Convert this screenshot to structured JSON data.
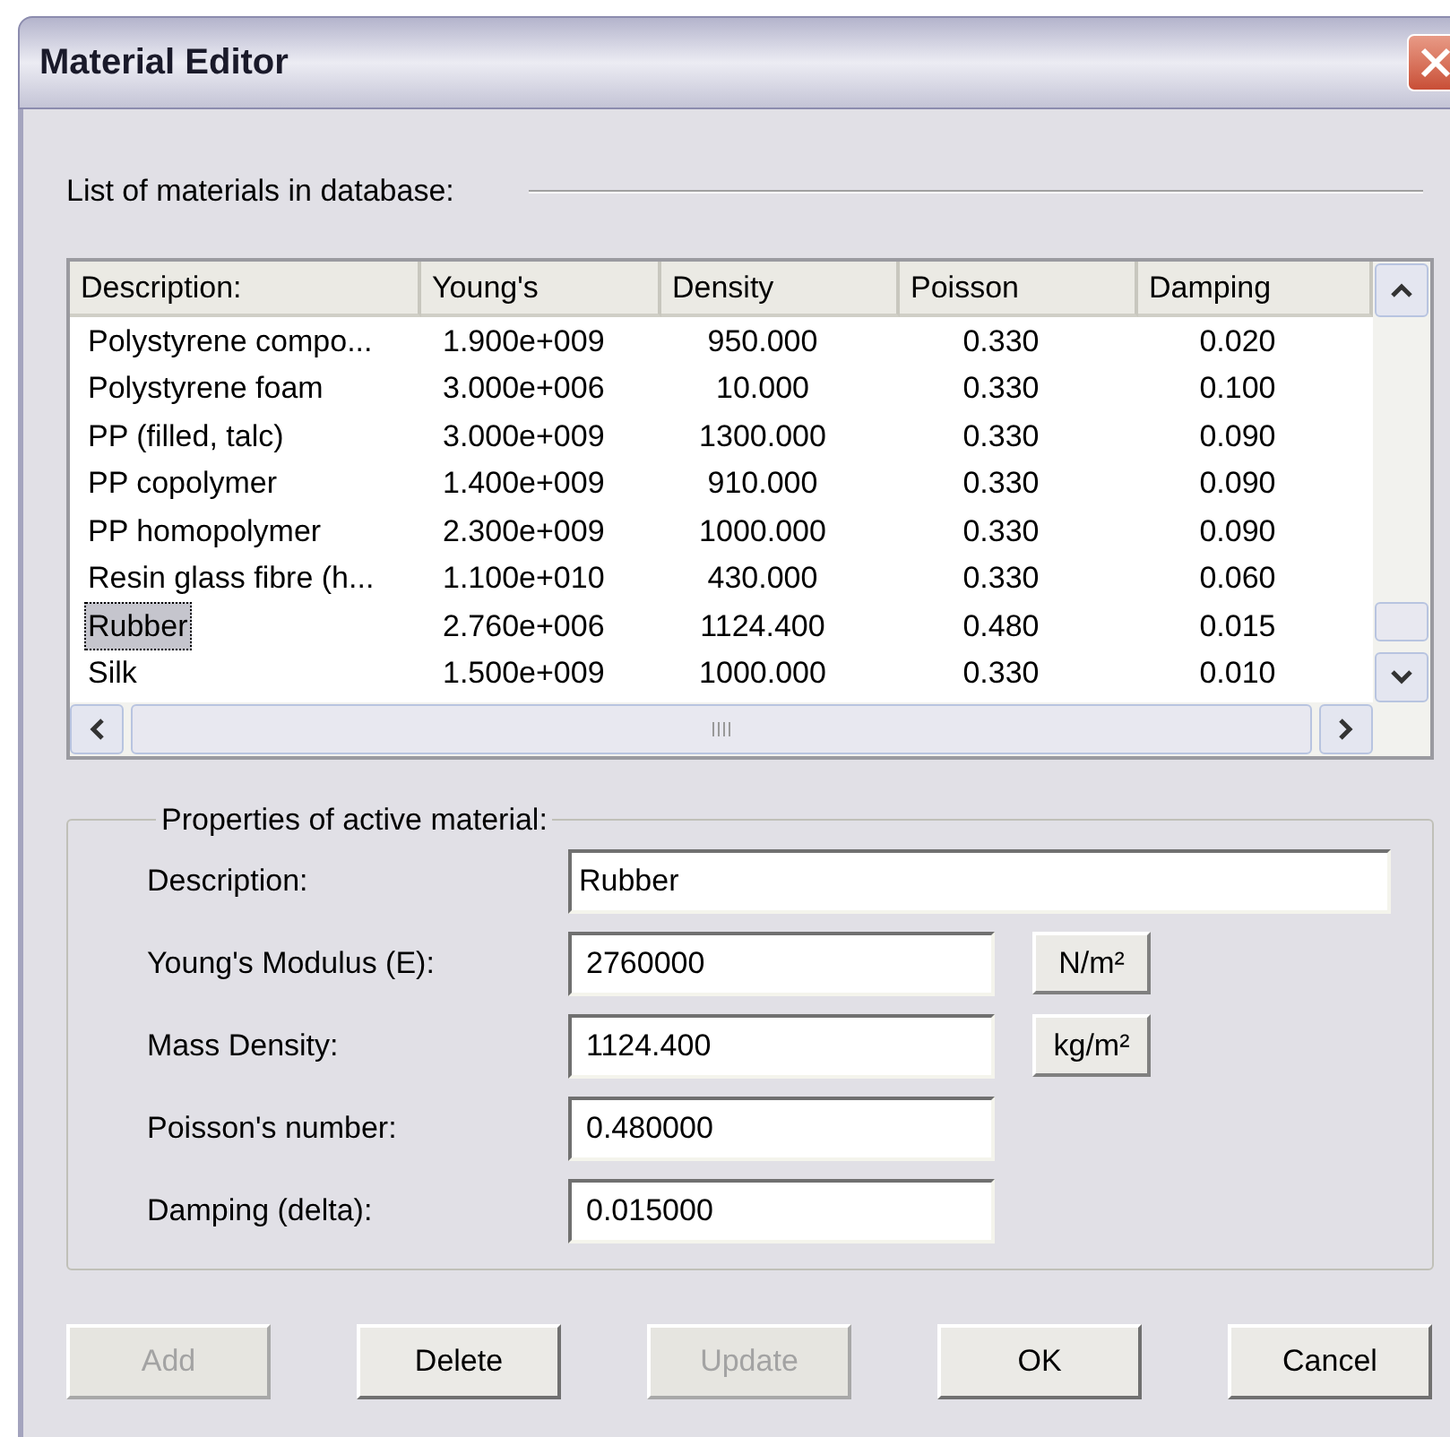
{
  "window": {
    "title": "Material Editor"
  },
  "list_section": {
    "label": "List of materials in database:"
  },
  "table": {
    "columns": [
      "Description:",
      "Young's",
      "Density",
      "Poisson",
      "Damping"
    ],
    "rows": [
      {
        "cells": [
          "Polystyrene compo...",
          "1.900e+009",
          "950.000",
          "0.330",
          "0.020"
        ],
        "selected": false
      },
      {
        "cells": [
          "Polystyrene foam",
          "3.000e+006",
          "10.000",
          "0.330",
          "0.100"
        ],
        "selected": false
      },
      {
        "cells": [
          "PP (filled, talc)",
          "3.000e+009",
          "1300.000",
          "0.330",
          "0.090"
        ],
        "selected": false
      },
      {
        "cells": [
          "PP copolymer",
          "1.400e+009",
          "910.000",
          "0.330",
          "0.090"
        ],
        "selected": false
      },
      {
        "cells": [
          "PP homopolymer",
          "2.300e+009",
          "1000.000",
          "0.330",
          "0.090"
        ],
        "selected": false
      },
      {
        "cells": [
          "Resin glass fibre (h...",
          "1.100e+010",
          "430.000",
          "0.330",
          "0.060"
        ],
        "selected": false
      },
      {
        "cells": [
          "Rubber",
          "2.760e+006",
          "1124.400",
          "0.480",
          "0.015"
        ],
        "selected": true
      },
      {
        "cells": [
          "Silk",
          "1.500e+009",
          "1000.000",
          "0.330",
          "0.010"
        ],
        "selected": false
      }
    ]
  },
  "properties": {
    "label": "Properties of active material:",
    "fields": [
      {
        "label": "Description:",
        "value": "Rubber",
        "kind": "wide"
      },
      {
        "label": "Young's Modulus (E):",
        "value": "2760000",
        "kind": "unit",
        "unit": "N/m²"
      },
      {
        "label": "Mass Density:",
        "value": "1124.400",
        "kind": "unit",
        "unit": "kg/m²"
      },
      {
        "label": "Poisson's number:",
        "value": "0.480000",
        "kind": "plain"
      },
      {
        "label": "Damping (delta):",
        "value": "0.015000",
        "kind": "plain"
      }
    ]
  },
  "buttons": [
    {
      "label": "Add",
      "disabled": true
    },
    {
      "label": "Delete",
      "disabled": false
    },
    {
      "label": "Update",
      "disabled": true
    },
    {
      "label": "OK",
      "disabled": false
    },
    {
      "label": "Cancel",
      "disabled": false
    }
  ]
}
